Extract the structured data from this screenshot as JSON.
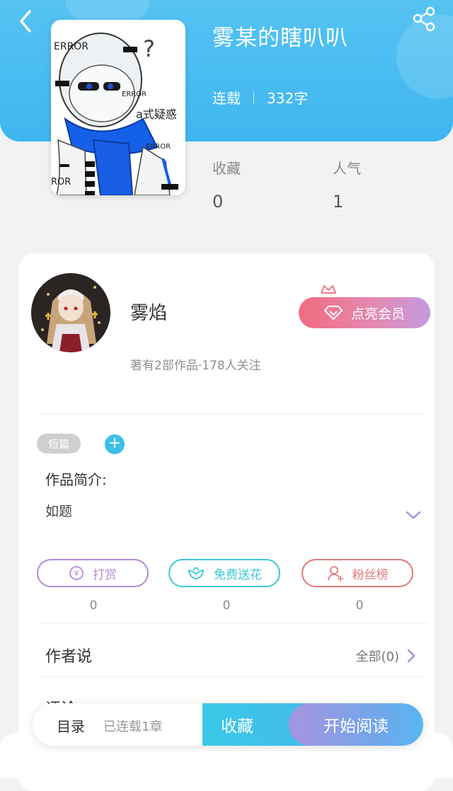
{
  "book": {
    "title": "雾某的瞎叭叭",
    "status": "连载",
    "word_count": "332字"
  },
  "cover_text": {
    "e1": "ERROR",
    "e2": "ERROR",
    "e3": "ERROR",
    "e4": "ROR",
    "caption": "a式疑惑",
    "question": "?"
  },
  "stats": [
    {
      "label": "收藏",
      "value": "0"
    },
    {
      "label": "人气",
      "value": "1"
    }
  ],
  "author": {
    "name": "雾焰",
    "meta": "著有2部作品·178人关注",
    "vip_label": "点亮会员"
  },
  "tag": "短篇",
  "tag_add": "+",
  "intro": {
    "label": "作品简介:",
    "text": "如题"
  },
  "actions": [
    {
      "label": "打赏",
      "count": "0",
      "color": "#b38ad8",
      "icon": "yen-icon"
    },
    {
      "label": "免费送花",
      "count": "0",
      "color": "#3cc7da",
      "icon": "flower-icon"
    },
    {
      "label": "粉丝榜",
      "count": "0",
      "color": "#e07a7a",
      "icon": "fan-icon"
    }
  ],
  "author_says": {
    "label": "作者说",
    "all": "全部(0)"
  },
  "comments_label": "评论",
  "bottom_bar": {
    "toc": "目录",
    "serial": "已连载1章",
    "favorite": "收藏",
    "read": "开始阅读"
  },
  "colors": {
    "header": "#46bbf0",
    "accent": "#3cbfe8"
  }
}
